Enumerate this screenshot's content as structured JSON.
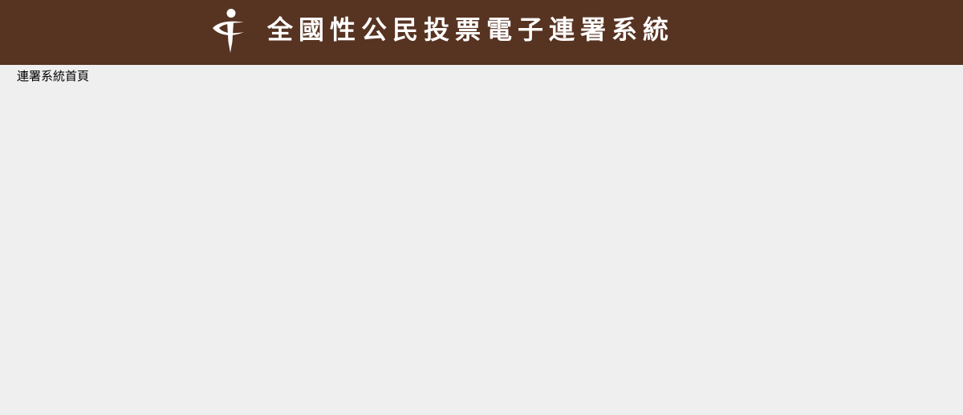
{
  "header": {
    "title": "全國性公民投票電子連署系統",
    "logo_icon": "citizen-i-icon",
    "background_color": "#573321",
    "title_color": "#ffffff"
  },
  "breadcrumb": {
    "home_label": "連署系統首頁"
  },
  "page": {
    "background_color": "#efefef"
  }
}
